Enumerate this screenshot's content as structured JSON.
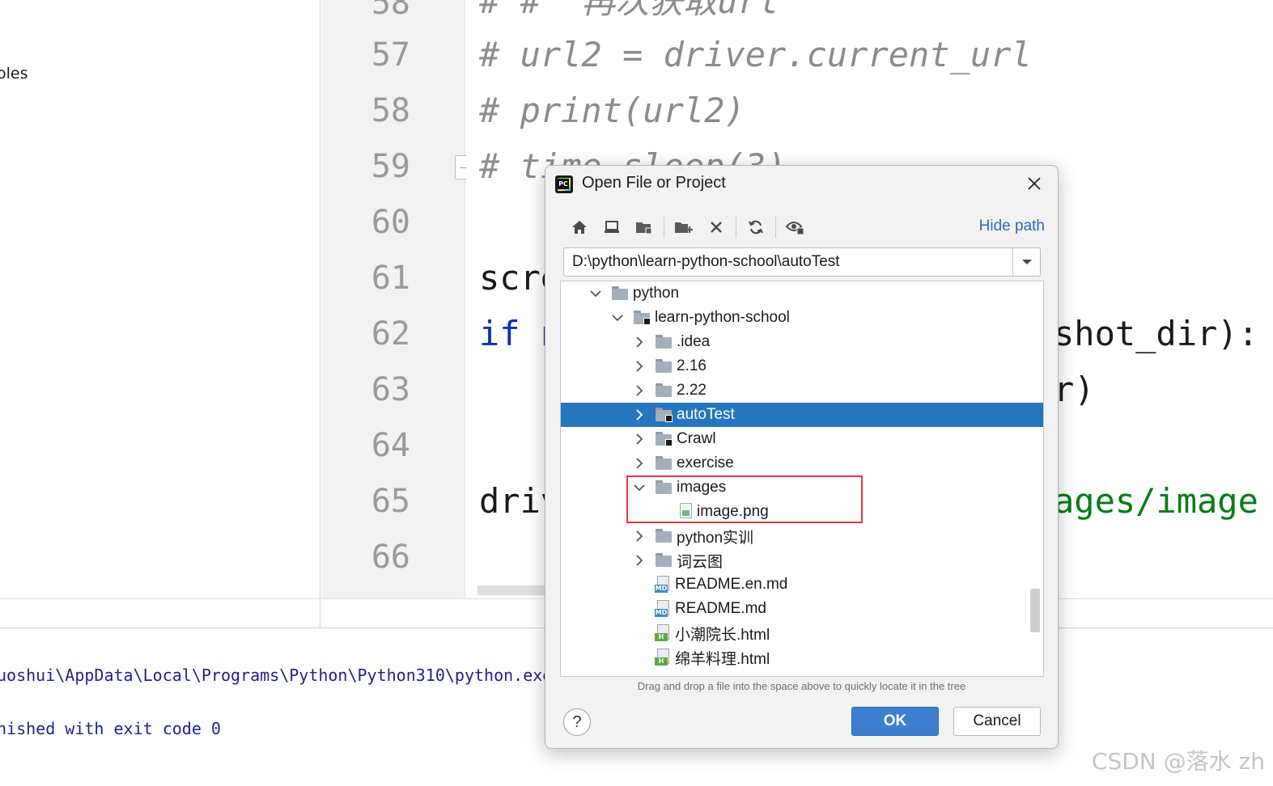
{
  "left_panel": {
    "node_label": "oles"
  },
  "gutter": {
    "line_numbers": [
      "58",
      "57",
      "58",
      "59",
      "60",
      "61",
      "62",
      "63",
      "64",
      "65",
      "66"
    ]
  },
  "editor": {
    "lines": [
      "# #  再次获取url",
      "# url2 = driver.current_url",
      "# print(url2)",
      "# time.sleep(3)",
      "scre",
      "if n",
      "",
      "driv"
    ],
    "right_fragments": {
      "line62": "shot_dir):",
      "line63": "r)",
      "line65": "ages/image"
    }
  },
  "console": {
    "line1": "uoshui\\AppData\\Local\\Programs\\Python\\Python310\\python.exe",
    "line2": "nished with exit code 0"
  },
  "watermark": "CSDN @落水 zh",
  "dialog": {
    "title": "Open File or Project",
    "hide_path_label": "Hide path",
    "path_value": "D:\\python\\learn-python-school\\autoTest",
    "hint": "Drag and drop a file into the space above to quickly locate it in the tree",
    "ok_label": "OK",
    "cancel_label": "Cancel",
    "help_label": "?",
    "tree": [
      {
        "label": "python",
        "type": "folder",
        "expanded": true
      },
      {
        "label": "learn-python-school",
        "type": "project-folder",
        "expanded": true
      },
      {
        "label": ".idea",
        "type": "folder",
        "expanded": false
      },
      {
        "label": "2.16",
        "type": "folder",
        "expanded": false
      },
      {
        "label": "2.22",
        "type": "folder",
        "expanded": false
      },
      {
        "label": "autoTest",
        "type": "project-folder",
        "expanded": false,
        "selected": true
      },
      {
        "label": "Crawl",
        "type": "project-folder",
        "expanded": false
      },
      {
        "label": "exercise",
        "type": "folder",
        "expanded": false
      },
      {
        "label": "images",
        "type": "folder",
        "expanded": true
      },
      {
        "label": "image.png",
        "type": "image-file"
      },
      {
        "label": "python实训",
        "type": "folder",
        "expanded": false
      },
      {
        "label": "词云图",
        "type": "folder",
        "expanded": false
      },
      {
        "label": "README.en.md",
        "type": "md-file"
      },
      {
        "label": "README.md",
        "type": "md-file"
      },
      {
        "label": "小潮院长.html",
        "type": "html-file"
      },
      {
        "label": "绵羊料理.html",
        "type": "html-file"
      }
    ]
  },
  "colors": {
    "selection": "#2675bf",
    "highlight_box": "#e0393e",
    "ok_button": "#3c7fd1",
    "link": "#2d6ab1"
  }
}
